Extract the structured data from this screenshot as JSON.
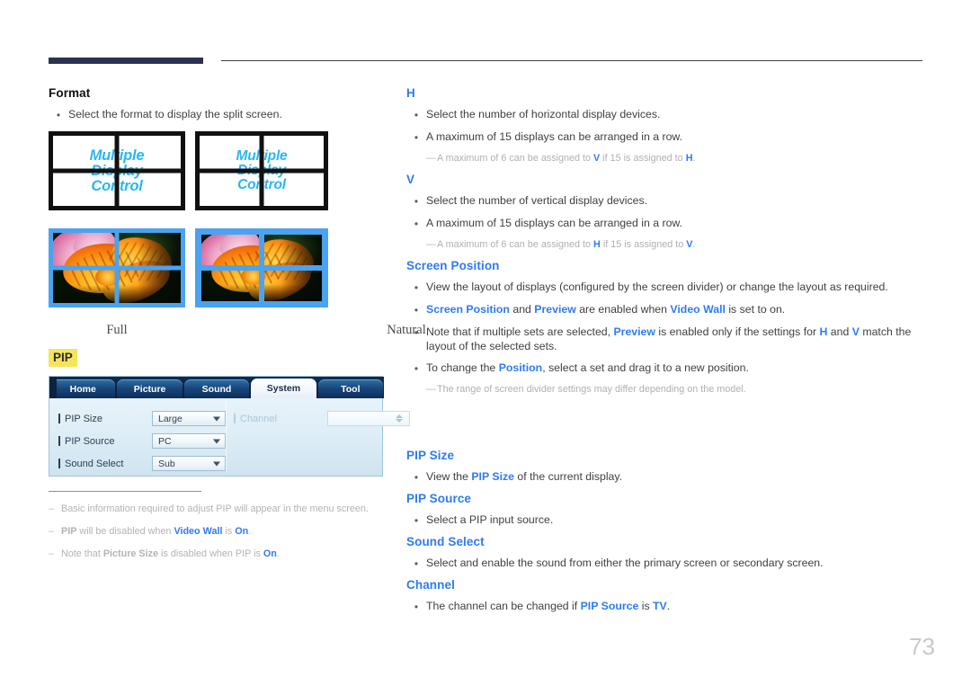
{
  "page": {
    "number": "73"
  },
  "left": {
    "format": {
      "heading": "Format",
      "bullet": "Select the format to display the split screen.",
      "tile_text_line1": "Multiple",
      "tile_text_line2": "Display",
      "tile_text_line3": "Control",
      "caption_full": "Full",
      "caption_natural": "Natural"
    },
    "pip": {
      "heading": "PIP",
      "osd": {
        "tabs": [
          "Home",
          "Picture",
          "Sound",
          "System",
          "Tool"
        ],
        "active_tab": "System",
        "rows": [
          {
            "label": "PIP Size",
            "value": "Large"
          },
          {
            "label": "PIP Source",
            "value": "PC"
          },
          {
            "label": "Sound Select",
            "value": "Sub"
          }
        ],
        "channel_label": "Channel",
        "channel_value": ""
      },
      "notes": [
        {
          "prefix": "",
          "text": "Basic information required to adjust PIP will appear in the menu screen.",
          "suffix": ""
        },
        {
          "pre": "",
          "k1": "PIP",
          "mid": " will be disabled when ",
          "b1": "Video Wall",
          "mid2": " is ",
          "b2": "On",
          "end": "."
        },
        {
          "pre": "Note that ",
          "k1": "Picture Size",
          "mid": " is disabled when PIP is ",
          "b2": "On",
          "end": "."
        }
      ]
    }
  },
  "right": {
    "h": {
      "heading": "H",
      "bullets": [
        "Select the number of horizontal display devices.",
        "A maximum of 15 displays can be arranged in a row."
      ],
      "note_pre": "A maximum of 6 can be assigned to ",
      "note_b1": "V",
      "note_mid": " if 15 is assigned to ",
      "note_b2": "H",
      "note_end": "."
    },
    "v": {
      "heading": "V",
      "bullets": [
        "Select the number of vertical display devices.",
        "A maximum of 15 displays can be arranged in a row."
      ],
      "note_pre": "A maximum of 6 can be assigned to ",
      "note_b1": "H",
      "note_mid": " if 15 is assigned to ",
      "note_b2": "V",
      "note_end": "."
    },
    "screen_position": {
      "heading": "Screen Position",
      "b1": "View the layout of displays (configured by the screen divider) or change the layout as required.",
      "b2_a": "Screen Position",
      "b2_b": " and ",
      "b2_c": "Preview",
      "b2_d": " are enabled when ",
      "b2_e": "Video Wall",
      "b2_f": " is set to on.",
      "b3_a": "Note that if multiple sets are selected, ",
      "b3_b": "Preview",
      "b3_c": " is enabled only if the settings for ",
      "b3_d": "H",
      "b3_e": " and ",
      "b3_f": "V",
      "b3_g": " match the layout of the selected sets.",
      "b4_a": "To change the ",
      "b4_b": "Position",
      "b4_c": ", select a set and drag it to a new position.",
      "note": "The range of screen divider settings may differ depending on the model."
    },
    "pip_size": {
      "heading": "PIP Size",
      "b_a": "View the ",
      "b_b": "PIP Size",
      "b_c": " of the current display."
    },
    "pip_source": {
      "heading": "PIP Source",
      "bullet": "Select a PIP input source."
    },
    "sound_select": {
      "heading": "Sound Select",
      "bullet": "Select and enable the sound from either the primary screen or secondary screen."
    },
    "channel": {
      "heading": "Channel",
      "b_a": "The channel can be changed if ",
      "b_b": "PIP Source",
      "b_c": " is ",
      "b_d": "TV",
      "b_e": "."
    }
  },
  "colors": {
    "accent_blue": "#2d7bf5",
    "marker_yellow": "#f6e45c",
    "header_navy": "#2c3152",
    "tile_cyan": "#29b6f0",
    "divider_blue": "#4aa3f0"
  }
}
